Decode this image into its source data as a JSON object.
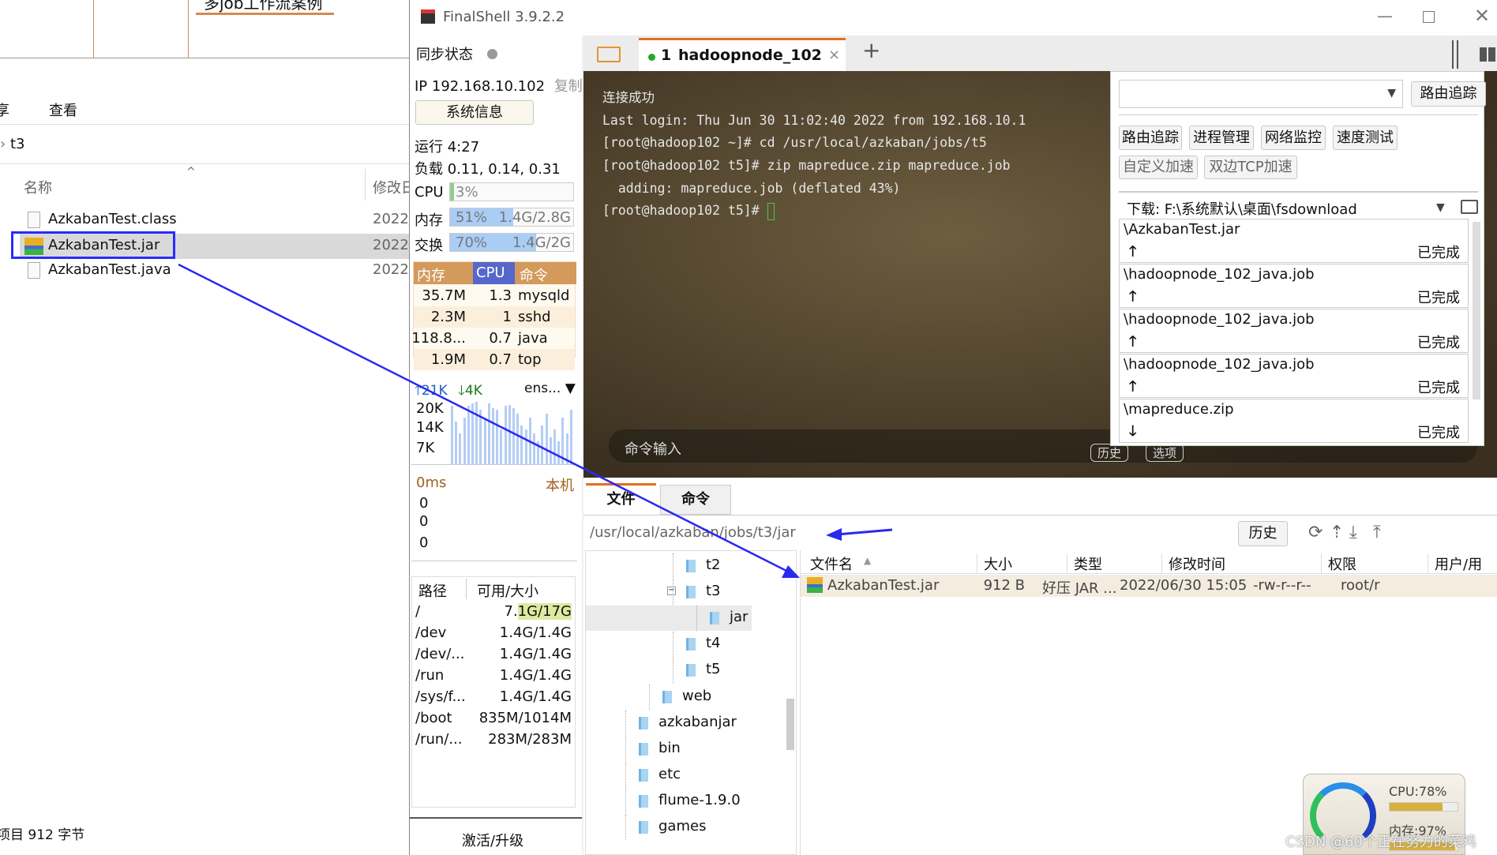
{
  "explorer": {
    "doc_heading": "多job工作流案例",
    "menu": [
      "享",
      "查看"
    ],
    "breadcrumb": "t3",
    "columns": {
      "name": "名称",
      "modified": "修改日"
    },
    "files": [
      {
        "name": "AzkabanTest.class",
        "date": "2022/",
        "icon": "file-icon"
      },
      {
        "name": "AzkabanTest.jar",
        "date": "2022/",
        "icon": "jar-archive-icon",
        "selected": true
      },
      {
        "name": "AzkabanTest.java",
        "date": "2022/",
        "icon": "file-icon"
      }
    ],
    "status": "项目  912 字节"
  },
  "finalshell": {
    "title": "FinalShell 3.9.2.2",
    "sync_label": "同步状态",
    "ip": "IP 192.168.10.102",
    "copy": "复制",
    "sysinfo_button": "系统信息",
    "uptime": "运行 4:27",
    "load": "负载 0.11, 0.14, 0.31",
    "cpu": {
      "label": "CPU",
      "text": "3%",
      "percent": 3
    },
    "mem": {
      "label": "内存",
      "text": "51%",
      "detail": "1.4G/2.8G",
      "percent": 51
    },
    "swap": {
      "label": "交换",
      "text": "70%",
      "detail": "1.4G/2G",
      "percent": 70
    },
    "proc_headers": [
      "内存",
      "CPU",
      "命令"
    ],
    "procs": [
      [
        "35.7M",
        "1.3",
        "mysqld"
      ],
      [
        "2.3M",
        "1",
        "sshd"
      ],
      [
        "118.8...",
        "0.7",
        "java"
      ],
      [
        "1.9M",
        "0.7",
        "top"
      ]
    ],
    "net": {
      "up": "21K",
      "down": "4K",
      "iface": "ens...",
      "ticks": [
        "20K",
        "14K",
        "7K"
      ]
    },
    "ping": {
      "latency": "0ms",
      "host": "本机",
      "values": [
        "0",
        "0",
        "0"
      ]
    },
    "disk_headers": [
      "路径",
      "可用/大小"
    ],
    "disks": [
      [
        "/",
        "7.1G/17G"
      ],
      [
        "/dev",
        "1.4G/1.4G"
      ],
      [
        "/dev/...",
        "1.4G/1.4G"
      ],
      [
        "/run",
        "1.4G/1.4G"
      ],
      [
        "/sys/f...",
        "1.4G/1.4G"
      ],
      [
        "/boot",
        "835M/1014M"
      ],
      [
        "/run/...",
        "283M/283M"
      ]
    ],
    "activate": "激活/升级",
    "tab": {
      "index": "1",
      "name": "hadoopnode_102",
      "status_color": "#22aa22"
    },
    "terminal": [
      "连接成功",
      "Last login: Thu Jun 30 11:02:40 2022 from 192.168.10.1",
      "[root@hadoop102 ~]# cd /usr/local/azkaban/jobs/t5",
      "[root@hadoop102 t5]# zip mapreduce.zip mapreduce.job",
      "  adding: mapreduce.job (deflated 43%)",
      "[root@hadoop102 t5]# "
    ],
    "command_input_placeholder": "命令输入",
    "terminal_buttons": [
      "历史",
      "选项"
    ],
    "tools": {
      "route_button": "路由追踪",
      "buttons": [
        "路由追踪",
        "进程管理",
        "网络监控",
        "速度测试"
      ],
      "buttons2": [
        "自定义加速",
        "双边TCP加速"
      ],
      "download_path": "下载: F:\\系统默认\\桌面\\fsdownload",
      "transfers": [
        {
          "name": "\\AzkabanTest.jar",
          "dir": "up",
          "status": "已完成"
        },
        {
          "name": "\\hadoopnode_102_java.job",
          "dir": "up",
          "status": "已完成"
        },
        {
          "name": "\\hadoopnode_102_java.job",
          "dir": "up",
          "status": "已完成"
        },
        {
          "name": "\\hadoopnode_102_java.job",
          "dir": "up",
          "status": "已完成"
        },
        {
          "name": "\\mapreduce.zip",
          "dir": "down",
          "status": "已完成"
        }
      ]
    },
    "bottom_tabs": [
      "文件",
      "命令"
    ],
    "path": "/usr/local/azkaban/jobs/t3/jar",
    "history_button": "历史",
    "tree": [
      {
        "name": "t2",
        "level": 3
      },
      {
        "name": "t3",
        "level": 3,
        "expanded": true
      },
      {
        "name": "jar",
        "level": 4,
        "selected": true
      },
      {
        "name": "t4",
        "level": 3
      },
      {
        "name": "t5",
        "level": 3
      },
      {
        "name": "web",
        "level": 2
      },
      {
        "name": "azkabanjar",
        "level": 1
      },
      {
        "name": "bin",
        "level": 1
      },
      {
        "name": "etc",
        "level": 1
      },
      {
        "name": "flume-1.9.0",
        "level": 1
      },
      {
        "name": "games",
        "level": 1
      }
    ],
    "file_headers": [
      "文件名",
      "大小",
      "类型",
      "修改时间",
      "权限",
      "用户/用"
    ],
    "file_rows": [
      [
        "AzkabanTest.jar",
        "912 B",
        "好压 JAR ...",
        "2022/06/30 15:05",
        "-rw-r--r--",
        "root/r"
      ]
    ]
  },
  "widget": {
    "cpu": "CPU:78%",
    "cpu_percent": 78,
    "mem": "内存:97%",
    "mem_percent": 97,
    "watermark": "CSDN @60个正在努力的菜鸡"
  }
}
